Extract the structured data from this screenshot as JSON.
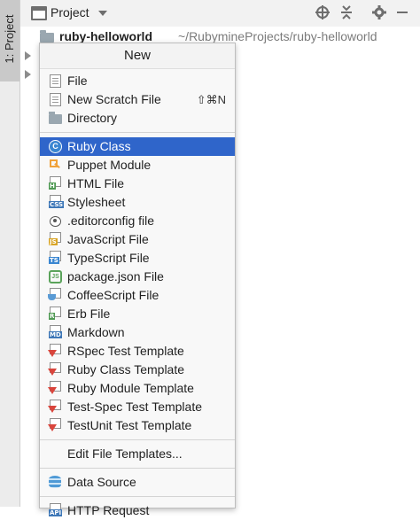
{
  "side_strip": {
    "tab_label": "1: Project"
  },
  "header": {
    "title": "Project",
    "buttons": [
      "locate-icon",
      "collapse-icon",
      "settings-icon",
      "hide-icon"
    ]
  },
  "tree": {
    "root_name": "ruby-helloworld",
    "root_path": "~/RubymineProjects/ruby-helloworld"
  },
  "menu": {
    "title": "New",
    "group1": [
      {
        "label": "File",
        "icon": "file-icon"
      },
      {
        "label": "New Scratch File",
        "icon": "scratch-file-icon",
        "shortcut": "⇧⌘N"
      },
      {
        "label": "Directory",
        "icon": "folder-icon"
      }
    ],
    "group2": [
      {
        "label": "Ruby Class",
        "icon": "ruby-class-icon",
        "selected": true
      },
      {
        "label": "Puppet Module",
        "icon": "puppet-icon"
      },
      {
        "label": "HTML File",
        "icon": "html-icon",
        "badge": "H",
        "badge_color": "#4f9a53"
      },
      {
        "label": "Stylesheet",
        "icon": "css-icon",
        "badge": "CSS",
        "badge_color": "#3f78b8"
      },
      {
        "label": ".editorconfig file",
        "icon": "editorconfig-icon"
      },
      {
        "label": "JavaScript File",
        "icon": "javascript-icon",
        "badge": "JS",
        "badge_color": "#d9a526"
      },
      {
        "label": "TypeScript File",
        "icon": "typescript-icon",
        "badge": "TS",
        "badge_color": "#3a86d1"
      },
      {
        "label": "package.json File",
        "icon": "nodejs-icon"
      },
      {
        "label": "CoffeeScript File",
        "icon": "coffeescript-icon"
      },
      {
        "label": "Erb File",
        "icon": "erb-icon",
        "badge": "R",
        "badge_color": "#4f9a53"
      },
      {
        "label": "Markdown",
        "icon": "markdown-icon",
        "badge": "MD",
        "badge_color": "#3f78b8"
      },
      {
        "label": "RSpec Test Template",
        "icon": "rspec-template-icon"
      },
      {
        "label": "Ruby Class Template",
        "icon": "ruby-class-template-icon"
      },
      {
        "label": "Ruby Module Template",
        "icon": "ruby-module-template-icon"
      },
      {
        "label": "Test-Spec Test Template",
        "icon": "test-spec-template-icon"
      },
      {
        "label": "TestUnit Test Template",
        "icon": "testunit-template-icon"
      }
    ],
    "group3": [
      {
        "label": "Edit File Templates..."
      }
    ],
    "group4": [
      {
        "label": "Data Source",
        "icon": "database-icon"
      }
    ],
    "group5": [
      {
        "label": "HTTP Request",
        "icon": "http-request-icon",
        "badge": "API",
        "badge_color": "#3f78b8"
      }
    ]
  },
  "colors": {
    "selection": "#2f65ca",
    "menu_background": "#f8f8f8",
    "strip_background": "#ececec"
  }
}
